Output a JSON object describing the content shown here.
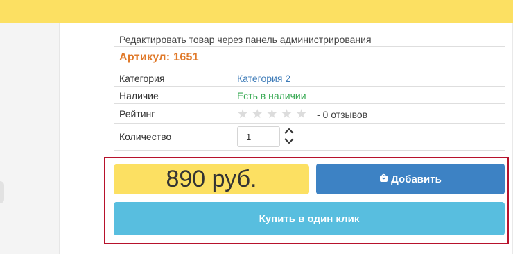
{
  "product": {
    "edit_link": "Редактировать товар через панель администрирования",
    "sku": "Артикул: 1651",
    "specs": {
      "category_label": "Категория",
      "category_value": "Категория 2",
      "availability_label": "Наличие",
      "availability_value": "Есть в наличии",
      "rating_label": "Рейтинг",
      "rating_stars_filled": 0,
      "rating_stars_total": 5,
      "reviews_text": "- 0 отзывов",
      "quantity_label": "Количество",
      "quantity_value": "1"
    },
    "price": "890 руб.",
    "add_to_cart_label": "Добавить",
    "buy_one_click_label": "Купить в один клик"
  },
  "colors": {
    "accent_yellow": "#fce062",
    "sku_orange": "#e07a2b",
    "link_blue": "#3f7cb8",
    "in_stock_green": "#3aaa55",
    "add_button_blue": "#3d82c4",
    "buy_button_cyan": "#58bedf",
    "highlight_border_red": "#b7122c"
  },
  "icons": {
    "add_to_cart": "bag-icon",
    "quantity_up": "chevron-up-icon",
    "quantity_down": "chevron-down-icon",
    "rating_star": "star-icon"
  }
}
